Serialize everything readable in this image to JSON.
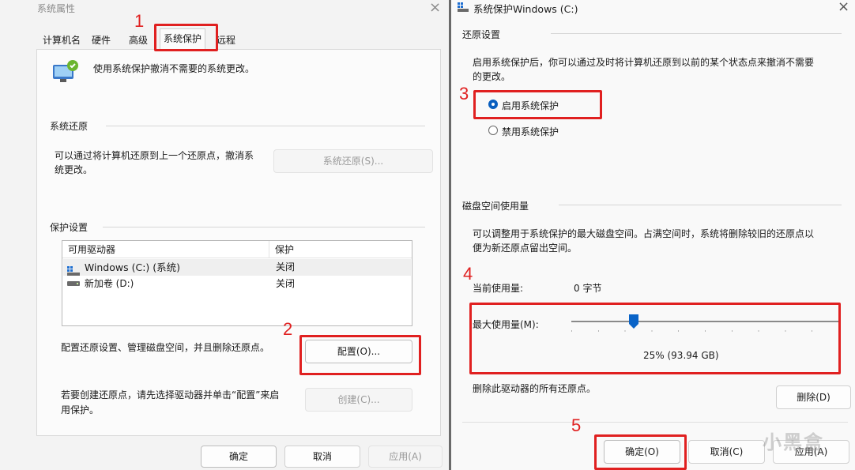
{
  "left": {
    "title": "系统属性",
    "close": "×",
    "tabs": [
      "计算机名",
      "硬件",
      "高级",
      "系统保护",
      "远程"
    ],
    "active_tab": "系统保护",
    "intro": "使用系统保护撤消不需要的系统更改。",
    "restore_section": "系统还原",
    "restore_desc_1": "可以通过将计算机还原到上一个还原点，撤消系",
    "restore_desc_2": "统更改。",
    "restore_button": "系统还原(S)...",
    "protect_section": "保护设置",
    "table": {
      "headers": [
        "可用驱动器",
        "保护"
      ],
      "rows": [
        {
          "drive": "Windows (C:) (系统)",
          "status": "关闭"
        },
        {
          "drive": "新加卷 (D:)",
          "status": "关闭"
        }
      ]
    },
    "config_desc": "配置还原设置、管理磁盘空间，并且删除还原点。",
    "config_button": "配置(O)...",
    "create_desc_1": "若要创建还原点，请先选择驱动器并单击“配置”来启",
    "create_desc_2": "用保护。",
    "create_button": "创建(C)...",
    "ok": "确定",
    "cancel": "取消",
    "apply": "应用(A)"
  },
  "right": {
    "title": "系统保护Windows (C:)",
    "close": "×",
    "restore_section": "还原设置",
    "restore_desc_1": "启用系统保护后，你可以通过及时将计算机还原到以前的某个状态点来撤消不需要",
    "restore_desc_2": "的更改。",
    "enable_label": "启用系统保护",
    "disable_label": "禁用系统保护",
    "selected": "enable",
    "disk_section": "磁盘空间使用量",
    "disk_desc_1": "可以调整用于系统保护的最大磁盘空间。占满空间时，系统将删除较旧的还原点以",
    "disk_desc_2": "便为新还原点留出空间。",
    "current_label": "当前使用量:",
    "current_value": "0 字节",
    "max_label": "最大使用量(M):",
    "max_fraction": 0.25,
    "max_value": "25% (93.94 GB)",
    "delete_desc": "删除此驱动器的所有还原点。",
    "delete_button": "删除(D)",
    "ok": "确定(O)",
    "cancel": "取消(C)",
    "apply": "应用(A)"
  },
  "annotations": [
    "1",
    "2",
    "3",
    "4",
    "5"
  ],
  "watermark": "小黑盒",
  "colors": {
    "annotation_red": "#e02020",
    "slider_blue": "#0a64c8",
    "radio_blue": "#0a5fbf"
  }
}
